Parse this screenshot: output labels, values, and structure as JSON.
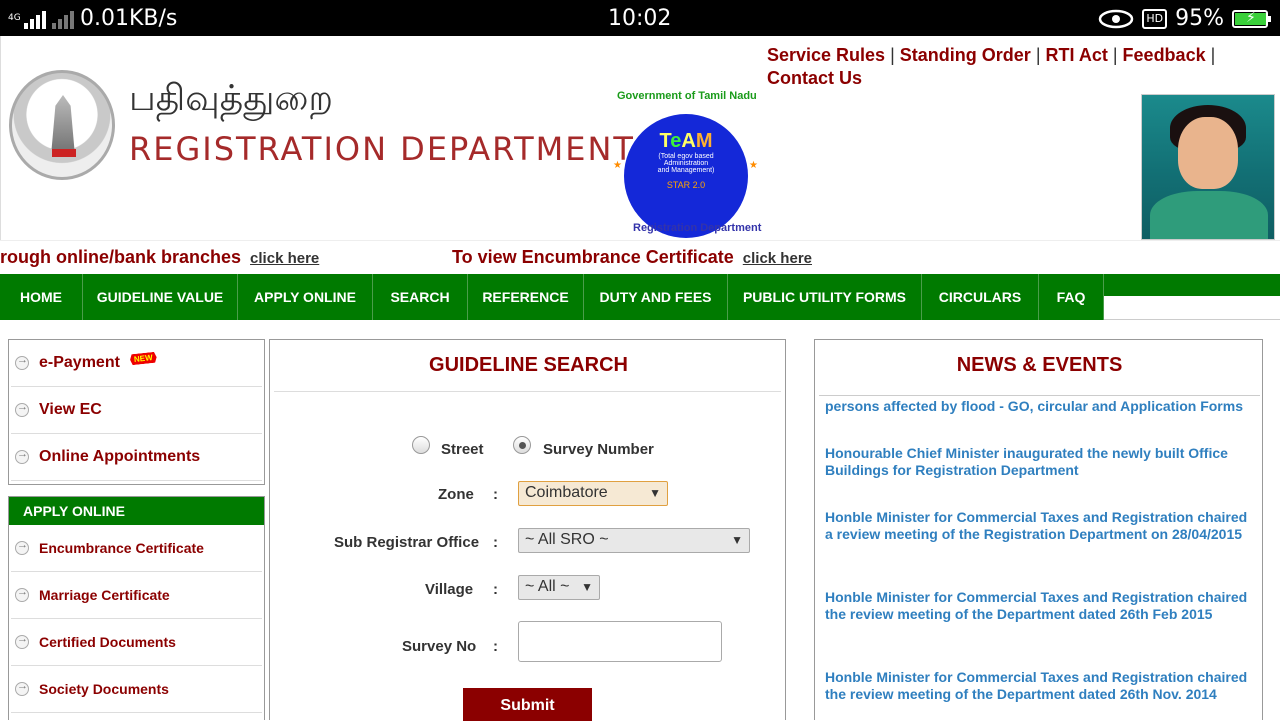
{
  "status_bar": {
    "network": "4G",
    "speed": "0.01KB/s",
    "time": "10:02",
    "hd": "HD",
    "battery": "95%"
  },
  "header": {
    "tamil_title": "பதிவுத்துறை",
    "dept_title": "REGISTRATION DEPARTMENT",
    "links": [
      "Service Rules",
      "Standing Order",
      "RTI Act",
      "Feedback",
      "Contact Us"
    ],
    "team_logo": {
      "arc_top": "Government of Tamil Nadu",
      "name": "TeAM",
      "sub1": "(Total egov based",
      "sub2": "Administration",
      "sub3": "and Management)",
      "star": "STAR 2.0",
      "arc_bottom": "Registration Department"
    }
  },
  "marquee": {
    "text1": "rough online/bank branches",
    "link1": "click here",
    "text2": "To view Encumbrance Certificate",
    "link2": "click here"
  },
  "nav": {
    "items": [
      "HOME",
      "GUIDELINE VALUE",
      "APPLY ONLINE",
      "SEARCH",
      "REFERENCE",
      "DUTY AND FEES",
      "PUBLIC UTILITY FORMS",
      "CIRCULARS",
      "FAQ"
    ]
  },
  "sidebar": {
    "quick": [
      "e-Payment",
      "View EC",
      "Online Appointments"
    ],
    "new_badge": "NEW",
    "apply_heading": "APPLY ONLINE",
    "apply_items": [
      "Encumbrance Certificate",
      "Marriage Certificate",
      "Certified Documents",
      "Society Documents"
    ]
  },
  "guideline": {
    "title": "GUIDELINE SEARCH",
    "radio_street": "Street",
    "radio_survey": "Survey Number",
    "zone_label": "Zone",
    "zone_value": "Coimbatore",
    "sro_label": "Sub Registrar Office",
    "sro_value": "~ All SRO ~",
    "village_label": "Village",
    "village_value": "~ All ~",
    "survey_label": "Survey No",
    "colon": ":",
    "submit": "Submit"
  },
  "news": {
    "title": "NEWS & EVENTS",
    "items": [
      "persons affected by flood - GO, circular and Application Forms",
      "Honourable Chief Minister inaugurated the newly built Office Buildings for Registration Department",
      "Honble Minister for Commercial Taxes and Registration chaired a review meeting of the Registration Department on 28/04/2015",
      "Honble Minister for Commercial Taxes and Registration chaired the review meeting of the Department dated 26th Feb 2015",
      "Honble Minister for Commercial Taxes and Registration chaired the review meeting of the Department dated 26th Nov. 2014"
    ]
  },
  "colors": {
    "brand_red": "#8b0000",
    "nav_green": "#007a00",
    "news_blue": "#2f7fbf"
  }
}
